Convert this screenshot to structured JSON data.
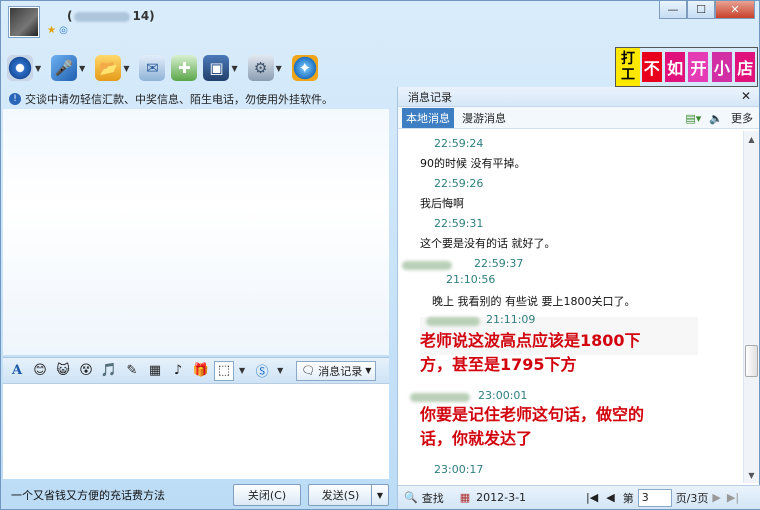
{
  "title": {
    "suffix": "14)"
  },
  "toolbar": {
    "icons": [
      "webcam-icon",
      "mic-icon",
      "folder-icon",
      "mail-icon",
      "add-chat-icon",
      "app-icon",
      "settings-icon",
      "browser-icon"
    ]
  },
  "banner": {
    "left": [
      "打",
      "工"
    ],
    "right": [
      "不",
      "如",
      "开",
      "小",
      "店"
    ]
  },
  "notice": "交谈中请勿轻信汇款、中奖信息、陌生电话，勿使用外挂软件。",
  "format_bar": {
    "record_label": "消息记录"
  },
  "bottom": {
    "ad_text": "一个又省钱又方便的充话费方法",
    "close_label": "关闭(C)",
    "send_label": "发送(S)"
  },
  "history": {
    "title": "消息记录",
    "tab_local": "本地消息",
    "tab_roam": "漫游消息",
    "more": "更多",
    "messages": [
      {
        "time": "22:59:24",
        "text": "90的时候 没有平掉。"
      },
      {
        "time": "22:59:26",
        "text": "我后悔啊"
      },
      {
        "time": "22:59:31",
        "text": "这个要是没有的话 就好了。"
      },
      {
        "time": "22:59:37",
        "text": ""
      },
      {
        "time": "21:10:56",
        "text": "晚上 我看别的 有些说 要上1800关口了。"
      },
      {
        "time": "21:11:09",
        "text": ""
      },
      {
        "time": "23:00:01",
        "text": ""
      },
      {
        "time": "23:00:17",
        "text": ""
      }
    ],
    "big_text_1a": "老师说这波高点应该是1800下",
    "big_text_1b": "方，甚至是1795下方",
    "big_text_2a": "你要是记住老师这句话，做空的",
    "big_text_2b": "话，你就发达了",
    "footer": {
      "find": "查找",
      "date": "2012-3-1",
      "page_prefix": "第",
      "page_value": "3",
      "page_suffix": "页/3页"
    }
  },
  "colors": {
    "accent": "#3d7fc2",
    "timestamp": "#2f7e7e",
    "highlight_text": "#d2050f"
  }
}
